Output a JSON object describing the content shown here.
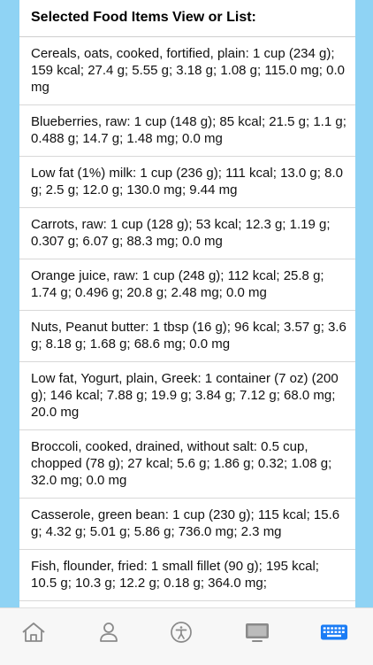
{
  "list": {
    "title": "Selected Food Items View or List:",
    "items": [
      "Cereals, oats, cooked, fortified, plain: 1 cup (234 g); 159 kcal; 27.4 g; 5.55 g; 3.18 g; 1.08 g; 115.0 mg; 0.0 mg",
      "Blueberries, raw: 1 cup (148 g); 85 kcal; 21.5 g; 1.1 g; 0.488 g; 14.7 g; 1.48 mg; 0.0 mg",
      "Low fat (1%) milk: 1 cup (236 g); 111 kcal; 13.0 g; 8.0 g; 2.5 g; 12.0 g; 130.0 mg; 9.44 mg",
      "Carrots, raw: 1 cup (128 g); 53 kcal; 12.3 g; 1.19 g; 0.307 g; 6.07 g; 88.3 mg; 0.0 mg",
      "Orange juice, raw: 1 cup (248 g); 112 kcal; 25.8 g; 1.74 g; 0.496 g; 20.8 g; 2.48 mg; 0.0 mg",
      "Nuts, Peanut butter: 1 tbsp (16 g); 96 kcal; 3.57 g; 3.6 g; 8.18 g; 1.68 g; 68.6 mg; 0.0 mg",
      "Low fat, Yogurt, plain, Greek: 1 container (7 oz) (200 g); 146 kcal; 7.88 g; 19.9 g; 3.84 g; 7.12 g; 68.0 mg; 20.0 mg",
      "Broccoli, cooked, drained, without salt: 0.5 cup, chopped (78 g); 27 kcal; 5.6 g; 1.86 g; 0.32; 1.08 g; 32.0 mg; 0.0 mg",
      "Casserole, green bean: 1 cup (230 g); 115 kcal; 15.6 g; 4.32 g; 5.01 g; 5.86 g; 736.0 mg; 2.3 mg",
      "Fish, flounder, fried: 1 small fillet (90 g); 195 kcal; 10.5 g; 10.3 g; 12.2 g; 0.18 g; 364.0 mg;"
    ]
  },
  "tabbar": {
    "tabs": [
      {
        "icon": "home-icon",
        "active": false
      },
      {
        "icon": "person-icon",
        "active": false
      },
      {
        "icon": "accessibility-icon",
        "active": false
      },
      {
        "icon": "display-icon",
        "active": false
      },
      {
        "icon": "keyboard-icon",
        "active": true
      }
    ],
    "colors": {
      "inactive": "#8a8a8a",
      "active": "#1a7cf5"
    }
  }
}
